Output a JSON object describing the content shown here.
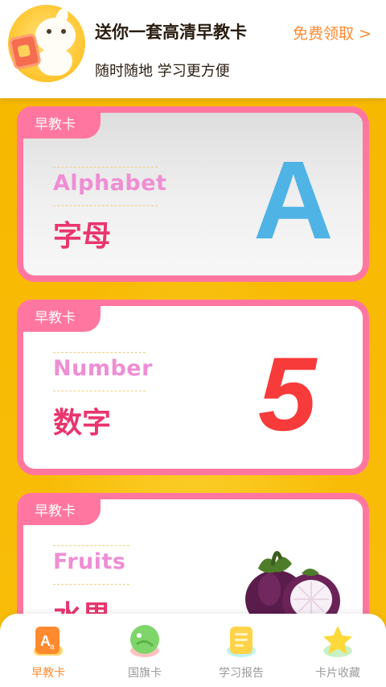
{
  "banner": {
    "title": "送你一套高清早教卡",
    "subtitle": "随时随地 学习更方便",
    "cta": "免费领取 >"
  },
  "cards": [
    {
      "tag": "早教卡",
      "english": "Alphabet",
      "chinese": "字母",
      "display": "A",
      "display_color": "#4fb3e6"
    },
    {
      "tag": "早教卡",
      "english": "Number",
      "chinese": "数字",
      "display": "5",
      "display_color": "#f73a3a"
    },
    {
      "tag": "早教卡",
      "english": "Fruits",
      "chinese": "水果",
      "display_icon": "mangosteen-icon"
    }
  ],
  "nav": [
    {
      "label": "早教卡",
      "icon": "alphabet-card-icon",
      "active": true
    },
    {
      "label": "国旗卡",
      "icon": "flag-card-icon",
      "active": false
    },
    {
      "label": "学习报告",
      "icon": "report-icon",
      "active": false
    },
    {
      "label": "卡片收藏",
      "icon": "star-collection-icon",
      "active": false
    }
  ],
  "colors": {
    "accent": "#ff8a33",
    "card_border": "#ff77a0",
    "chinese_text": "#e8366e",
    "english_text": "#ee8ed3",
    "background": "#f6b400"
  }
}
